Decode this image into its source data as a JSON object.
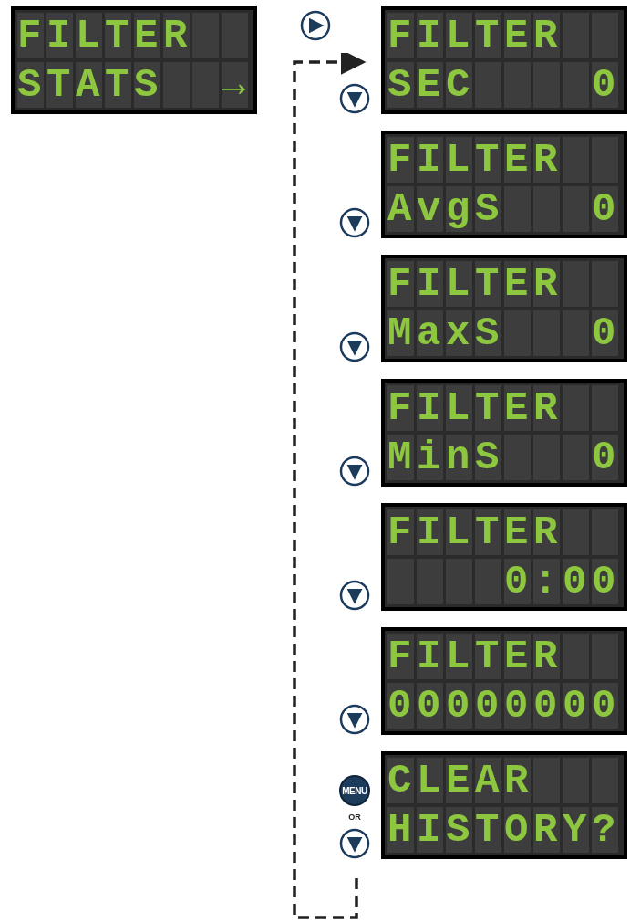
{
  "start_screen": {
    "lines": [
      "FILTER",
      "STATS  →"
    ]
  },
  "enter_button": {
    "kind": "right"
  },
  "steps": [
    {
      "lines": [
        "FILTER",
        "SEC    0"
      ],
      "controls": [
        {
          "kind": "down"
        }
      ]
    },
    {
      "lines": [
        "FILTER",
        "AvgS   0"
      ],
      "controls": [
        {
          "kind": "down"
        }
      ]
    },
    {
      "lines": [
        "FILTER",
        "MaxS   0"
      ],
      "controls": [
        {
          "kind": "down"
        }
      ]
    },
    {
      "lines": [
        "FILTER",
        "MinS   0"
      ],
      "controls": [
        {
          "kind": "down"
        }
      ]
    },
    {
      "lines": [
        "FILTER",
        "    0:00"
      ],
      "controls": [
        {
          "kind": "down"
        }
      ]
    },
    {
      "lines": [
        "FILTER",
        "00000000"
      ],
      "controls": [
        {
          "kind": "down"
        }
      ]
    },
    {
      "lines": [
        "CLEAR",
        "HISTORY?"
      ],
      "controls": [
        {
          "kind": "menu",
          "label": "MENU"
        },
        {
          "kind": "or",
          "label": "OR"
        },
        {
          "kind": "down"
        }
      ]
    }
  ]
}
